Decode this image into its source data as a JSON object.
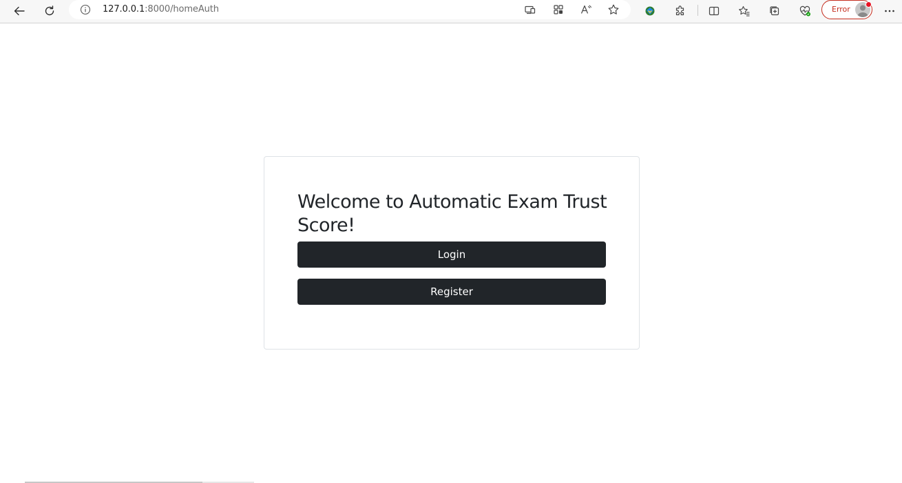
{
  "browser": {
    "url_host": "127.0.0.1",
    "url_path": ":8000/homeAuth",
    "profile_status": "Error",
    "icons": {
      "back": "back-arrow-icon",
      "reload": "reload-icon",
      "site_info": "info-icon",
      "app_available": "app-available-icon",
      "split_view": "apps-grid-icon",
      "read_aloud": "read-aloud-icon",
      "favorite": "star-icon",
      "extension_idm": "idm-extension-icon",
      "extensions": "puzzle-piece-icon",
      "split_screen": "split-screen-icon",
      "favorites": "favorites-icon",
      "collections": "collections-icon",
      "browser_essentials": "heart-pulse-icon",
      "more": "more-dots-icon"
    },
    "accent_error_color": "#c42b1c"
  },
  "auth_card": {
    "title": "Welcome to Automatic Exam Trust Score!",
    "login_label": "Login",
    "register_label": "Register",
    "button_color": "#212529"
  }
}
